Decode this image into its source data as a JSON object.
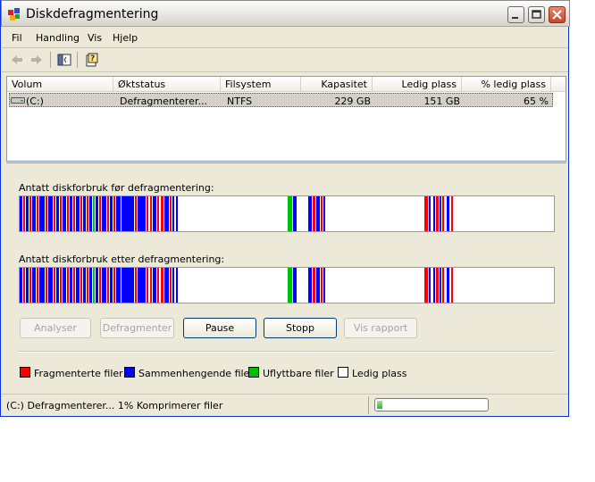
{
  "window": {
    "title": "Diskdefragmentering"
  },
  "menu": [
    {
      "label": "Fil"
    },
    {
      "label": "Handling"
    },
    {
      "label": "Vis"
    },
    {
      "label": "Hjelp"
    }
  ],
  "list": {
    "headers": [
      "Volum",
      "Øktstatus",
      "Filsystem",
      "Kapasitet",
      "Ledig plass",
      "% ledig plass"
    ],
    "rows": [
      {
        "volume": "(C:)",
        "status": "Defragmenterer...",
        "filesystem": "NTFS",
        "capacity": "229 GB",
        "free": "151 GB",
        "free_pct": "65 %"
      }
    ]
  },
  "before_label": "Antatt diskforbruk før defragmentering:",
  "after_label": "Antatt diskforbruk etter defragmentering:",
  "buttons": {
    "analyze": "Analyser",
    "defrag": "Defragmenter",
    "pause": "Pause",
    "stop": "Stopp",
    "report": "Vis rapport"
  },
  "legend": {
    "fragmented": "Fragmenterte filer",
    "contiguous": "Sammenhengende filer",
    "unmovable": "Uflyttbare filer",
    "free": "Ledig plass"
  },
  "colors": {
    "fragmented": "#ff0000",
    "contiguous": "#0000ff",
    "unmovable": "#00c000",
    "free": "#ffffff"
  },
  "status": {
    "text": "(C:) Defragmenterer...  1%  Komprimerer filer",
    "progress": 0.01
  }
}
